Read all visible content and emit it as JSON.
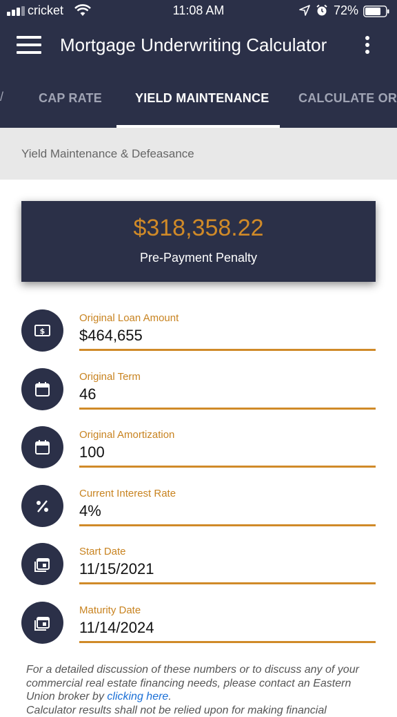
{
  "status_bar": {
    "carrier": "cricket",
    "time": "11:08 AM",
    "battery": "72%"
  },
  "app_bar": {
    "title": "Mortgage Underwriting Calculator"
  },
  "tabs": [
    {
      "label": "CAP RATE",
      "active": false
    },
    {
      "label": "YIELD MAINTENANCE",
      "active": true
    },
    {
      "label": "CALCULATE ORIG",
      "active": false
    }
  ],
  "section": {
    "title": "Yield Maintenance & Defeasance"
  },
  "result": {
    "amount": "$318,358.22",
    "label": "Pre-Payment Penalty"
  },
  "fields": [
    {
      "label": "Original Loan Amount",
      "value": "$464,655",
      "icon": "money-icon"
    },
    {
      "label": "Original Term",
      "value": "46",
      "icon": "calendar-icon"
    },
    {
      "label": "Original Amortization",
      "value": "100",
      "icon": "calendar-icon"
    },
    {
      "label": "Current Interest Rate",
      "value": "4%",
      "icon": "percent-icon"
    },
    {
      "label": "Start Date",
      "value": "11/15/2021",
      "icon": "calendar-range-icon"
    },
    {
      "label": "Maturity Date",
      "value": "11/14/2024",
      "icon": "calendar-range-icon"
    }
  ],
  "disclaimer": {
    "text": "For a detailed discussion of these numbers or to discuss any of your commercial real estate financing needs, please contact an Eastern Union broker by ",
    "link": "clicking here",
    "after": ".",
    "line2": "Calculator results shall not be relied upon for making financial"
  },
  "colors": {
    "navy": "#2b3048",
    "accent": "#d08a28",
    "link": "#1a6fd6"
  }
}
